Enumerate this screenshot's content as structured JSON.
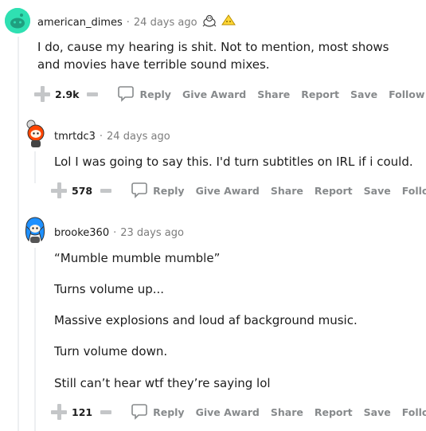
{
  "comments": [
    {
      "user": "american_dimes",
      "separator": "·",
      "time": "24 days ago",
      "awards": [
        "wholesome-seal-award-icon",
        "gold-award-icon"
      ],
      "body": [
        "I do, cause my hearing is shit. Not to mention, most shows and movies have terrible sound mixes."
      ],
      "score": "2.9k",
      "avatar_color": "#2fe0b2"
    },
    {
      "user": "tmrtdc3",
      "separator": "·",
      "time": "24 days ago",
      "body": [
        "Lol I was going to say this. I'd turn subtitles on IRL if i could."
      ],
      "score": "578",
      "avatar_color": "#ff4500"
    },
    {
      "user": "brooke360",
      "separator": "·",
      "time": "23 days ago",
      "body": [
        "“Mumble mumble mumble”",
        "Turns volume up...",
        "Massive explosions and loud af background music.",
        "Turn volume down.",
        "Still can’t hear wtf they’re saying lol"
      ],
      "score": "121",
      "avatar_color": "#1e90ff"
    }
  ],
  "actions": {
    "reply": "Reply",
    "give_award": "Give Award",
    "share": "Share",
    "report": "Report",
    "save": "Save",
    "follow": "Follow"
  }
}
